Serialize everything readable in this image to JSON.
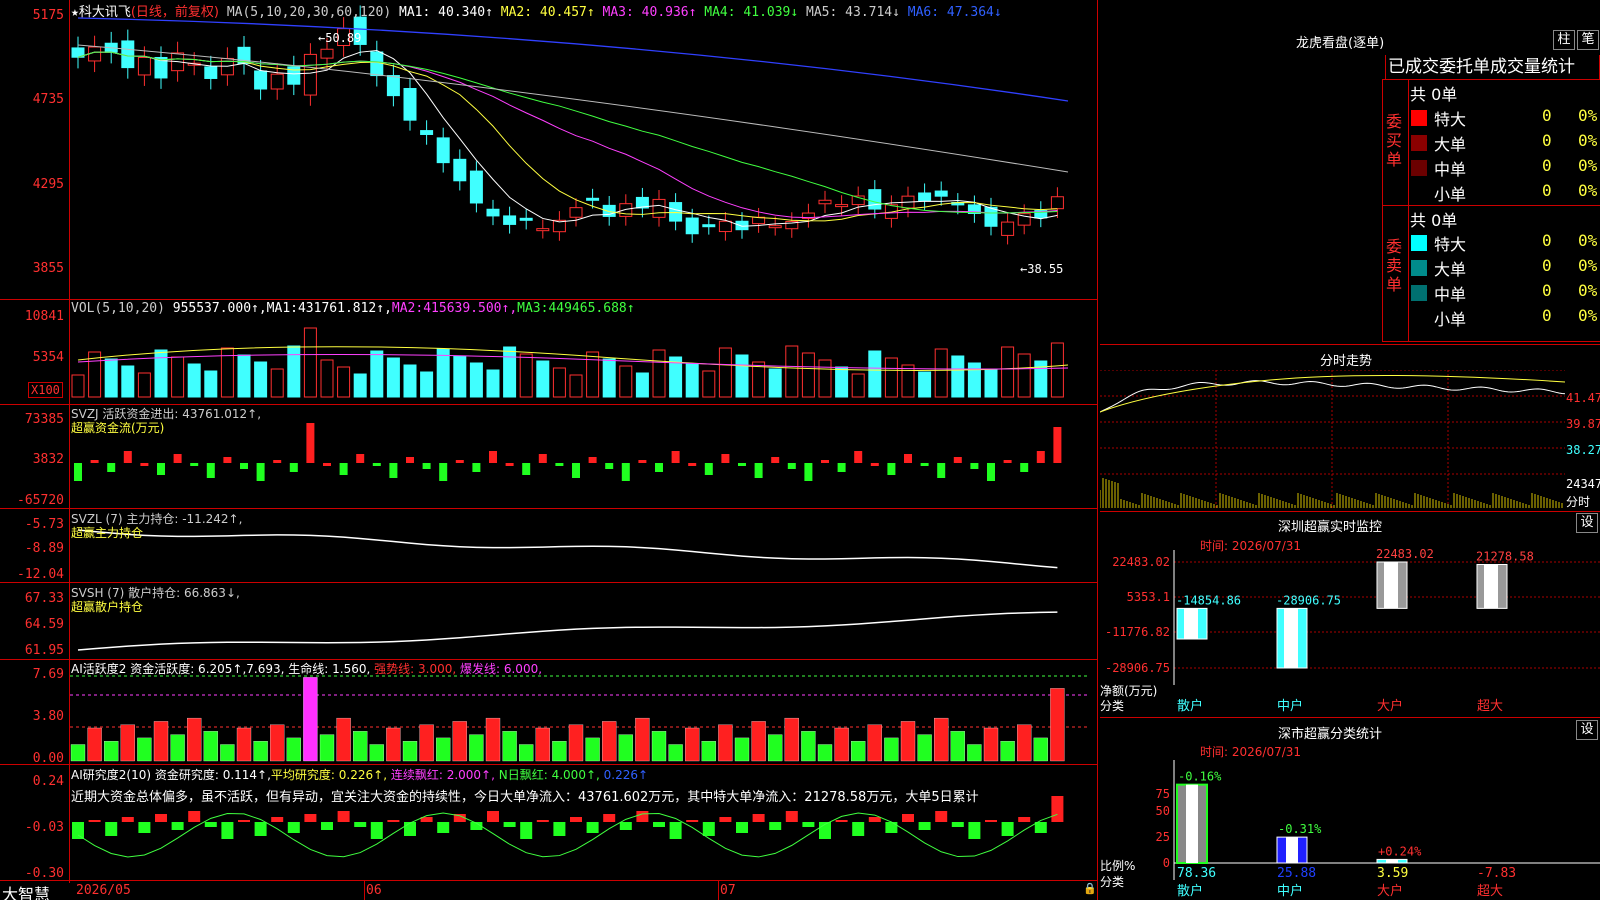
{
  "main": {
    "title": "科大讯飞",
    "mode": "(日线，前复权)",
    "ma_label": "MA(5,10,20,30,60,120)",
    "ma": [
      {
        "k": "MA1",
        "v": "40.340↑",
        "c": "#ffffff"
      },
      {
        "k": "MA2",
        "v": "40.457↑",
        "c": "#ffff40"
      },
      {
        "k": "MA3",
        "v": "40.936↑",
        "c": "#ff40ff"
      },
      {
        "k": "MA4",
        "v": "41.039↓",
        "c": "#40ff40"
      },
      {
        "k": "MA5",
        "v": "43.714↓",
        "c": "#cccccc"
      },
      {
        "k": "MA6",
        "v": "47.364↓",
        "c": "#3060ff"
      }
    ],
    "yticks": [
      "5175",
      "4735",
      "4295",
      "3855"
    ],
    "high_label": "50.89",
    "low_label": "38.55"
  },
  "vol": {
    "header": "VOL(5,10,20)",
    "v": "955537.000↑",
    "ma1": "431761.812↑",
    "ma2": "415639.500↑",
    "ma3": "449465.688↑",
    "yticks": [
      "10841",
      "5354"
    ],
    "unit": "X100"
  },
  "svzj": {
    "header": "SVZJ  活跃资金进出: 43761.012↑,",
    "sub": "超赢资金流(万元)",
    "yticks": [
      "73385",
      "3832",
      "-65720"
    ]
  },
  "svzl": {
    "header": "SVZL (7) 主力持仓: -11.242↑,",
    "sub": "超赢主力持仓",
    "yticks": [
      "-5.73",
      "-8.89",
      "-12.04"
    ]
  },
  "svsh": {
    "header": "SVSH (7) 散户持仓: 66.863↓,",
    "sub": "超赢散户持仓",
    "yticks": [
      "67.33",
      "64.59",
      "61.95"
    ]
  },
  "ai1": {
    "header": "AI活跃度2 资金活跃度: 6.205↑,",
    "v2": "7.693,",
    "life": "生命线: 1.560,",
    "strong": "强势线: 3.000,",
    "burst": "爆发线: 6.000,",
    "yticks": [
      "7.69",
      "3.80",
      "0.00"
    ]
  },
  "ai2": {
    "header": "AI研究度2(10) 资金研究度: 0.114↑,",
    "avg": "平均研究度: 0.226↑,",
    "red": "连续飘红: 2.000↑,",
    "nred": "N日飘红: 4.000↑,",
    "last": "0.226↑",
    "yticks": [
      "0.24",
      "-0.03",
      "-0.30"
    ],
    "scroll": "近期大资金总体偏多，虽不活跃，但有异动，宜关注大资金的持续性，今日大单净流入：43761.602万元，其中特大单净流入：21278.58万元，大单5日累计"
  },
  "bottom": {
    "brand": "大智慧",
    "dates": [
      "2026/05",
      "06",
      "07"
    ]
  },
  "lhb": {
    "title": "龙虎看盘(逐单)",
    "btn1": "柱",
    "btn2": "笔",
    "tabs": "已成交委托单成交量统计",
    "buy": {
      "side": "委买单",
      "total": "共 0单",
      "rows": [
        {
          "n": "特大",
          "c": "#ff0000",
          "v": "0",
          "p": "0%"
        },
        {
          "n": "大单",
          "c": "#8b0000",
          "v": "0",
          "p": "0%"
        },
        {
          "n": "中单",
          "c": "#6b0000",
          "v": "0",
          "p": "0%"
        },
        {
          "n": "小单",
          "c": "",
          "v": "0",
          "p": "0%"
        }
      ]
    },
    "sell": {
      "side": "委卖单",
      "total": "共 0单",
      "rows": [
        {
          "n": "特大",
          "c": "#00ffff",
          "v": "0",
          "p": "0%"
        },
        {
          "n": "大单",
          "c": "#008b8b",
          "v": "0",
          "p": "0%"
        },
        {
          "n": "中单",
          "c": "#007070",
          "v": "0",
          "p": "0%"
        },
        {
          "n": "小单",
          "c": "",
          "v": "0",
          "p": "0%"
        }
      ]
    }
  },
  "intraday": {
    "title": "分时走势",
    "yticks": [
      "41.47",
      "39.87",
      "38.27",
      "24347"
    ],
    "unit": "分时"
  },
  "monitor": {
    "title": "深圳超赢实时监控",
    "btn": "设",
    "time": "时间: 2026/07/31",
    "yticks": [
      "22483.02",
      "5353.1",
      "-11776.82",
      "-28906.75"
    ],
    "ylabel": "净额(万元)",
    "xlabel": "分类",
    "cats": [
      "散户",
      "中户",
      "大户",
      "超大"
    ],
    "values": [
      -14854.86,
      -28906.75,
      22483.02,
      21278.58
    ],
    "labels": [
      "-14854.86",
      "-28906.75",
      "22483.02",
      "21278.58"
    ]
  },
  "stat": {
    "title": "深市超赢分类统计",
    "btn": "设",
    "time": "时间: 2026/07/31",
    "yticks": [
      "75",
      "50",
      "25",
      "0"
    ],
    "ylabel": "比例%",
    "xlabel": "分类",
    "cats": [
      "散户",
      "中户",
      "大户",
      "超大"
    ],
    "values": [
      78.36,
      25.88,
      3.59,
      -7.83
    ],
    "vlabels": [
      "78.36",
      "25.88",
      "3.59",
      "-7.83"
    ],
    "chg": [
      "-0.16%",
      "-0.31%",
      "+0.24%",
      ""
    ]
  }
}
